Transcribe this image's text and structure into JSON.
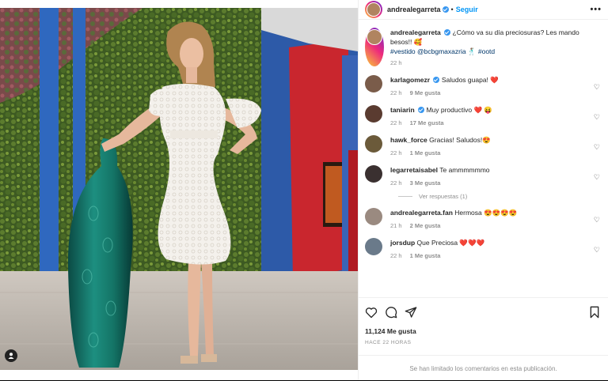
{
  "post": {
    "username": "andrealegarreta",
    "follow_label": "Seguir",
    "more_label": "•••",
    "caption_text": "¿Cómo va su día preciosuras? Les mando besos!! 🥰",
    "caption_tags": "#vestido @bcbgmaxazria 🕺🏽 #ootd",
    "caption_time": "22 h",
    "likes": "11,124 Me gusta",
    "date": "HACE 22 HORAS",
    "comments_limited": "Se han limitado los comentarios en esta publicación."
  },
  "comments": [
    {
      "user": "karlagomezr",
      "verified": true,
      "text": "Saludos guapa! ❤️",
      "time": "22 h",
      "likes": "9 Me gusta",
      "avatar_color": "#7a5c4a"
    },
    {
      "user": "taniarin",
      "verified": true,
      "text": "Muy productivo ❤️ 😝",
      "time": "22 h",
      "likes": "17 Me gusta",
      "avatar_color": "#5a3b30"
    },
    {
      "user": "hawk_force",
      "verified": false,
      "text": "Gracias! Saludos!😍",
      "time": "22 h",
      "likes": "1 Me gusta",
      "avatar_color": "#6b5a3a"
    },
    {
      "user": "legarretaisabel",
      "verified": false,
      "text": "Te ammmmmmo",
      "time": "22 h",
      "likes": "3 Me gusta",
      "avatar_color": "#3a3030"
    },
    {
      "user": "andrealegarreta.fan",
      "verified": false,
      "text": "Hermosa 😍😍😍😍",
      "time": "21 h",
      "likes": "2 Me gusta",
      "avatar_color": "#9a8a80"
    },
    {
      "user": "jorsdup",
      "verified": false,
      "text": "Que Preciosa ❤️❤️❤️",
      "time": "22 h",
      "likes": "1 Me gusta",
      "avatar_color": "#6a7a8a"
    }
  ],
  "replies_label": "Ver respuestas (1)",
  "colors": {
    "accent": "#0095f6",
    "verified": "#3897f0",
    "muted": "#8e8e8e"
  }
}
